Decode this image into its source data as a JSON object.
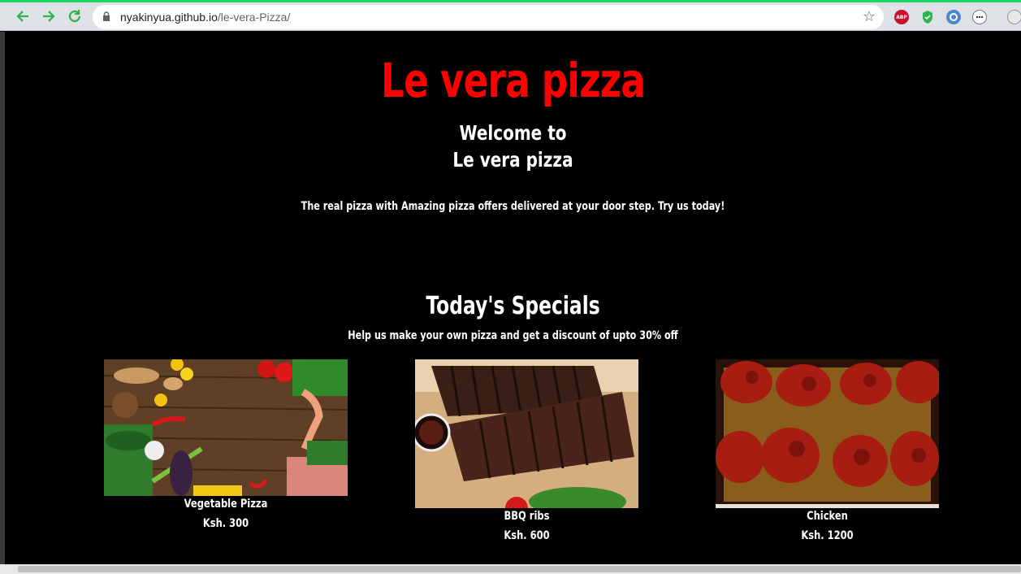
{
  "browser": {
    "url_host": "nyakinyua.github.io",
    "url_path": "/le-vera-Pizza/",
    "extensions": [
      "adblock-plus-icon",
      "shield-extension-icon",
      "circle-extension-icon",
      "dots-extension-icon",
      "profile-icon"
    ],
    "abp_label": "ABP"
  },
  "header": {
    "brand": "Le vera pizza",
    "welcome_line1": "Welcome to",
    "welcome_line2": "Le vera pizza",
    "tagline": "The real pizza with Amazing pizza offers delivered at your door step. Try us today!"
  },
  "specials": {
    "title": "Today's Specials",
    "subtitle": "Help us make your own pizza and get a discount of upto 30% off",
    "items": [
      {
        "name": "Vegetable Pizza",
        "price": "Ksh. 300"
      },
      {
        "name": "BBQ ribs",
        "price": "Ksh. 600"
      },
      {
        "name": "Chicken",
        "price": "Ksh. 1200"
      }
    ]
  },
  "colors": {
    "brand": "#ff0000",
    "background": "#000000",
    "text": "#ffffff",
    "loading_bar": "#1ed760"
  }
}
